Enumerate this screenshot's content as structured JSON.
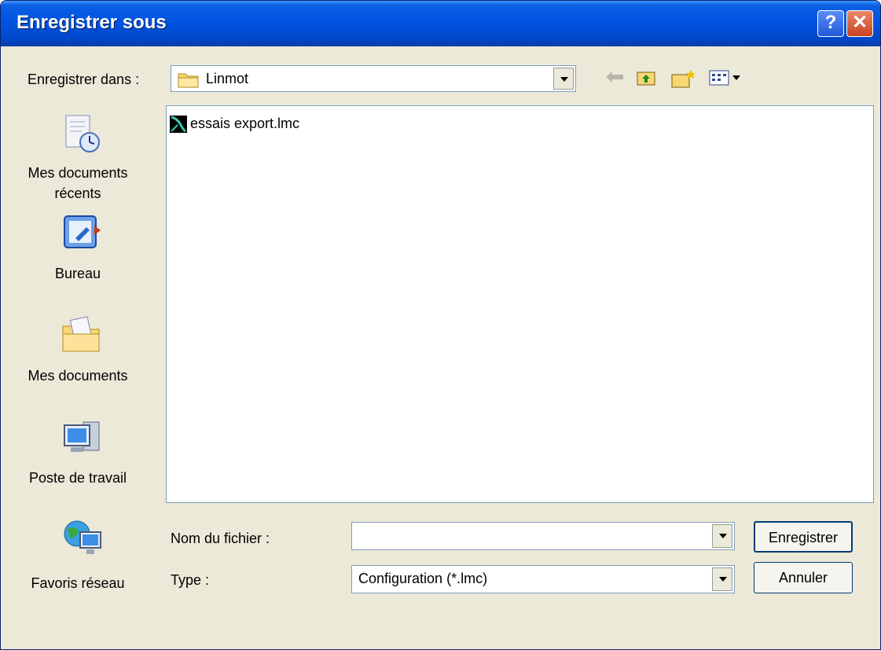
{
  "dialog": {
    "title": "Enregistrer sous"
  },
  "titlebar": {
    "help_label": "?",
    "close_label": "✕"
  },
  "lookin": {
    "label": "Enregistrer dans :",
    "value": "Linmot"
  },
  "toolbar": {
    "icons": [
      "back-icon",
      "up-folder-icon",
      "new-folder-icon",
      "views-icon"
    ]
  },
  "places": [
    {
      "label": "Mes documents récents",
      "icon": "recent-documents-icon"
    },
    {
      "label": "Bureau",
      "icon": "desktop-icon"
    },
    {
      "label": "Mes documents",
      "icon": "my-documents-icon"
    },
    {
      "label": "Poste de travail",
      "icon": "my-computer-icon"
    },
    {
      "label": "Favoris réseau",
      "icon": "network-places-icon"
    }
  ],
  "files": [
    {
      "name": "essais export.lmc",
      "icon": "lmc-file-icon"
    }
  ],
  "filename": {
    "label": "Nom du fichier :",
    "value": ""
  },
  "filetype": {
    "label": "Type :",
    "value": "Configuration (*.lmc)"
  },
  "buttons": {
    "save": "Enregistrer",
    "cancel": "Annuler"
  },
  "colors": {
    "titlebar": "#0054e3",
    "dialog_bg": "#ece9d8",
    "close": "#c9401f"
  }
}
